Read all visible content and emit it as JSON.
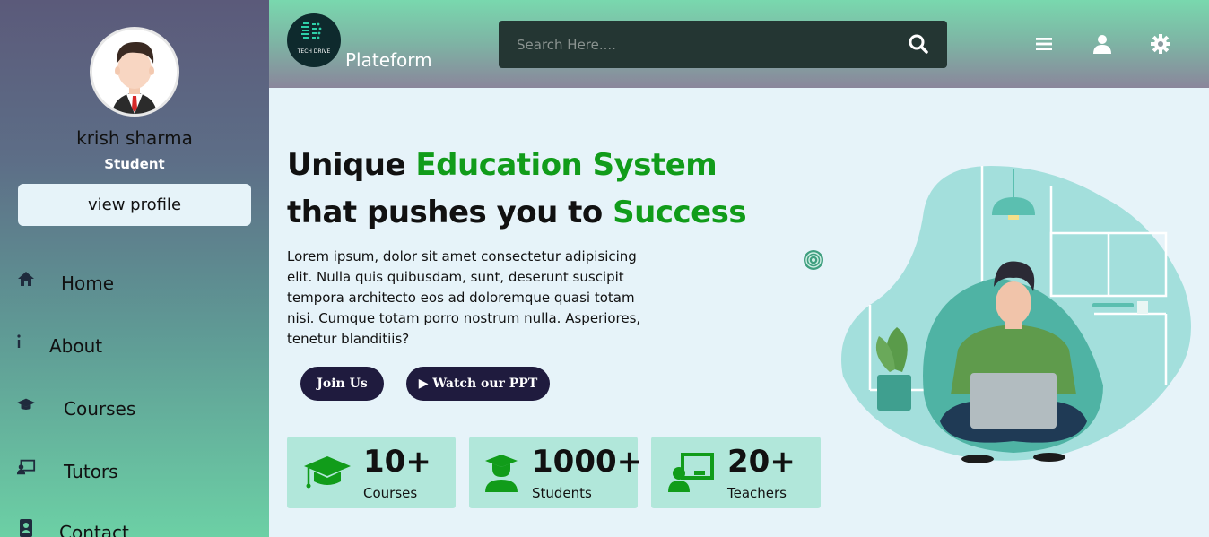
{
  "sidebar": {
    "user_name": "krish sharma",
    "user_role": "Student",
    "view_profile_label": "view profile",
    "nav": [
      {
        "label": "Home",
        "icon": "home-icon"
      },
      {
        "label": "About",
        "icon": "info-icon"
      },
      {
        "label": "Courses",
        "icon": "graduation-cap-icon"
      },
      {
        "label": "Tutors",
        "icon": "teacher-board-icon"
      },
      {
        "label": "Contact",
        "icon": "address-book-icon"
      }
    ]
  },
  "header": {
    "logo_text": "TECH DRIVE",
    "brand": "Plateform",
    "search_placeholder": "Search Here....",
    "icons": [
      "menu-icon",
      "user-icon",
      "settings-icon"
    ]
  },
  "hero": {
    "title_line1_a": "Unique ",
    "title_line1_b": "Education System",
    "title_line2_a": "that pushes you to ",
    "title_line2_b": "Success",
    "description": "Lorem ipsum, dolor sit amet consectetur adipisicing elit. Nulla quis quibusdam, sunt, deserunt suscipit tempora architecto eos ad doloremque quasi totam nisi. Cumque totam porro nostrum nulla. Asperiores, tenetur blanditiis?",
    "join_label": "Join Us",
    "watch_label": "▶ Watch our PPT"
  },
  "stats": [
    {
      "value": "10+",
      "label": "Courses",
      "icon": "graduation-cap-icon"
    },
    {
      "value": "1000+",
      "label": "Students",
      "icon": "student-icon"
    },
    {
      "value": "20+",
      "label": "Teachers",
      "icon": "teacher-board-icon"
    }
  ],
  "colors": {
    "accent_green": "#119c1a",
    "button_dark": "#1f1b3e",
    "background": "#e6f3f9",
    "stat_card": "#b1e7da"
  }
}
